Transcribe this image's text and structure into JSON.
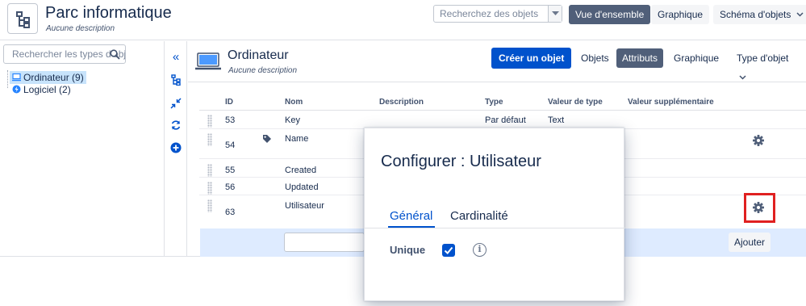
{
  "header": {
    "schema_title": "Parc informatique",
    "schema_description": "Aucune description",
    "search_placeholder": "Recherchez des objets",
    "nav": {
      "overview": "Vue d'ensemble",
      "graph": "Graphique",
      "schema_menu": "Schéma d'objets"
    }
  },
  "sidebar": {
    "search_placeholder": "Rechercher les types d'objet",
    "items": [
      {
        "label": "Ordinateur (9)",
        "selected": true,
        "icon": "computer-icon"
      },
      {
        "label": "Logiciel (2)",
        "selected": false,
        "icon": "software-icon"
      }
    ]
  },
  "rail_icons": [
    "collapse-left-icon",
    "tree-icon",
    "collapse-arrows-icon",
    "refresh-icon",
    "add-circle-icon"
  ],
  "object_type": {
    "title": "Ordinateur",
    "description": "Aucune description",
    "create_button": "Créer un objet",
    "tabs": {
      "objects": "Objets",
      "attributes": "Attributs",
      "graph": "Graphique",
      "type_menu": "Type d'objet"
    }
  },
  "table": {
    "columns": {
      "id": "ID",
      "name": "Nom",
      "description": "Description",
      "type": "Type",
      "type_value": "Valeur de type",
      "extra_value": "Valeur supplémentaire"
    },
    "rows": [
      {
        "id": "53",
        "name": "Key",
        "type": "Par défaut",
        "type_value": "Text"
      },
      {
        "id": "54",
        "name": "Name",
        "type": "",
        "type_value": ""
      },
      {
        "id": "55",
        "name": "Created",
        "type": "",
        "type_value": ""
      },
      {
        "id": "56",
        "name": "Updated",
        "type": "",
        "type_value": ""
      },
      {
        "id": "63",
        "name": "Utilisateur",
        "type": "",
        "type_value": ""
      }
    ],
    "add_button": "Ajouter"
  },
  "dialog": {
    "title": "Configurer : Utilisateur",
    "tabs": {
      "general": "Général",
      "cardinality": "Cardinalité"
    },
    "unique_label": "Unique",
    "unique_checked": true
  },
  "colors": {
    "primary": "#0052cc",
    "selected_tab": "#505f79",
    "highlight": "#e02020",
    "add_row_bg": "#deebff"
  }
}
